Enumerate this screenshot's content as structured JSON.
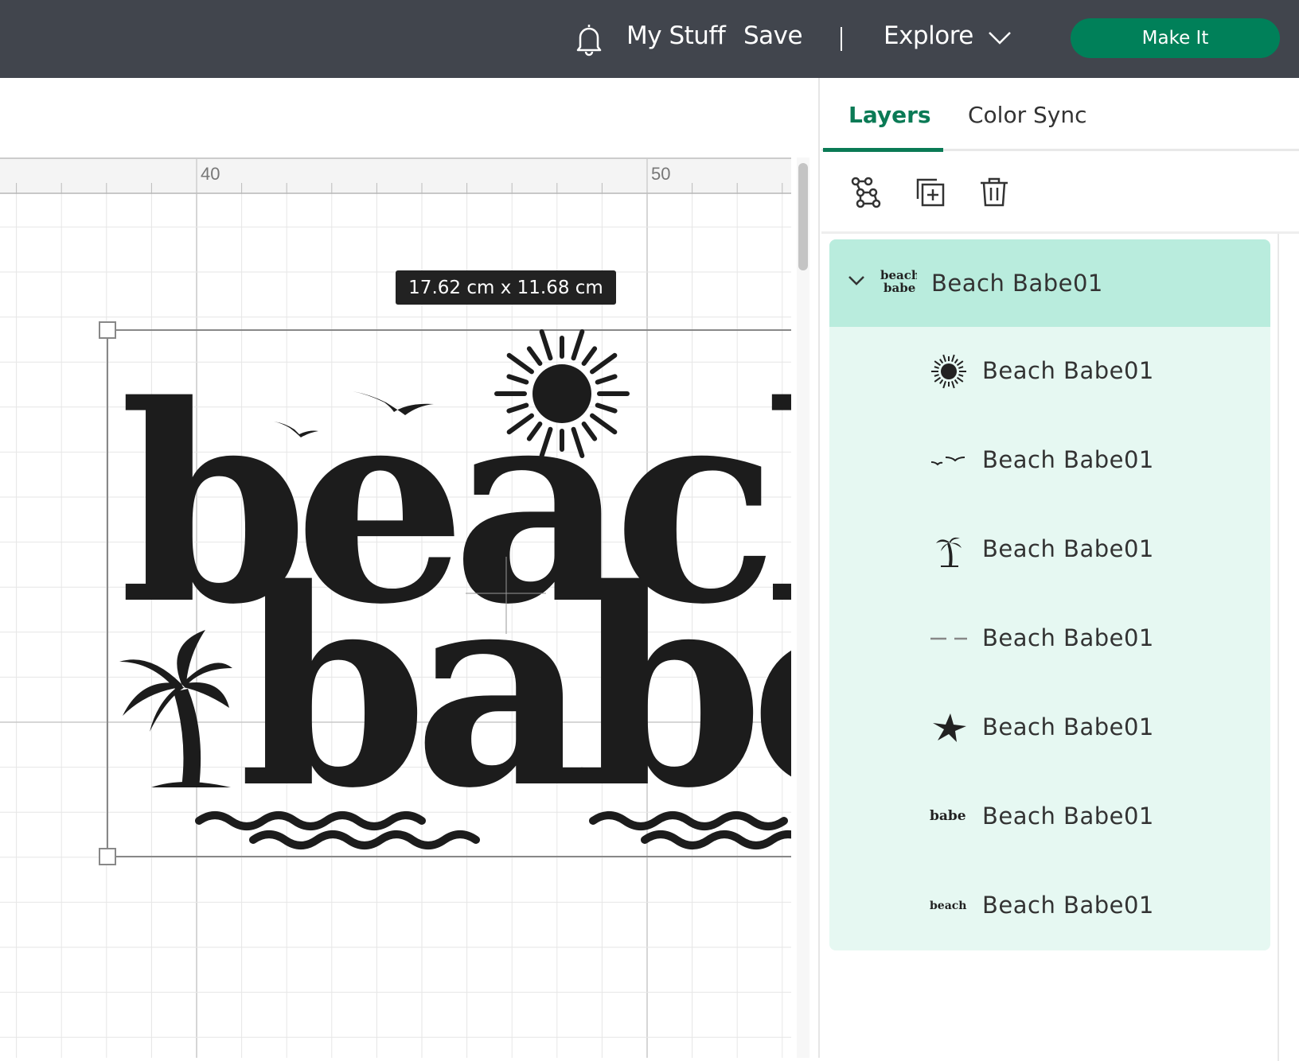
{
  "header": {
    "my_stuff": "My Stuff",
    "save": "Save",
    "divider": "|",
    "explore": "Explore",
    "make_it": "Make It",
    "icons": {
      "notifications": "bell-icon",
      "explore_menu": "chevron-down-icon"
    }
  },
  "canvas": {
    "ruler_labels": [
      "40",
      "50"
    ],
    "dimensions": "17.62  cm x 11.68  cm",
    "artwork": {
      "line1": "beach",
      "line2": "babe"
    }
  },
  "panel": {
    "tabs": [
      {
        "label": "Layers",
        "active": true
      },
      {
        "label": "Color Sync",
        "active": false
      }
    ],
    "toolbar": [
      "group-icon",
      "duplicate-icon",
      "delete-icon"
    ],
    "layers": [
      {
        "name": "Beach Babe01",
        "type": "group",
        "expanded": true,
        "selected": true,
        "thumb": "beach-babe-thumbnail"
      },
      {
        "name": "Beach Babe01",
        "thumb": "sun-thumbnail"
      },
      {
        "name": "Beach Babe01",
        "thumb": "birds-thumbnail"
      },
      {
        "name": "Beach Babe01",
        "thumb": "palm-tree-thumbnail"
      },
      {
        "name": "Beach Babe01",
        "thumb": "waves-thumbnail"
      },
      {
        "name": "Beach Babe01",
        "thumb": "starfish-thumbnail"
      },
      {
        "name": "Beach Babe01",
        "thumb": "babe-text-thumbnail",
        "thumb_text": "babe"
      },
      {
        "name": "Beach Babe01",
        "thumb": "beach-text-thumbnail",
        "thumb_text": "beach"
      }
    ]
  },
  "colors": {
    "header_bg": "#41454d",
    "accent": "#008059",
    "group_selected": "#b9ecdd",
    "layer_bg": "#e6f8f2"
  }
}
